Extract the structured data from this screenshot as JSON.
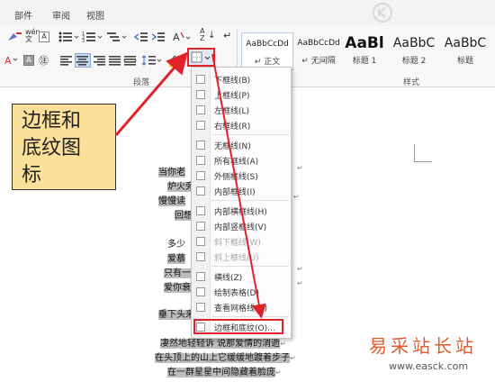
{
  "tabs": [
    "部件",
    "审阅",
    "视图"
  ],
  "ribbon": {
    "para_group_label": "段落",
    "styles_group_label": "样式",
    "font_glyphs": {
      "wen": "wén\n文",
      "a_box": "A",
      "a_shade": "A",
      "a_color": "A"
    },
    "sort_glyph": "A↓Z",
    "pilcrow": "↵"
  },
  "styles": [
    {
      "sample": "AaBbCcDd",
      "name": "↵ 正文"
    },
    {
      "sample": "AaBbCcDd",
      "name": "↵ 无间隔"
    },
    {
      "sample": "AaBl",
      "name": "标题 1"
    },
    {
      "sample": "AaBbC",
      "name": "标题 2"
    },
    {
      "sample": "AaBbC",
      "name": "标题"
    }
  ],
  "border_menu": {
    "items": [
      {
        "label": "下框线(B)",
        "disabled": false
      },
      {
        "label": "上框线(P)",
        "disabled": false
      },
      {
        "label": "左框线(L)",
        "disabled": false
      },
      {
        "label": "右框线(R)",
        "disabled": false
      },
      {
        "label": "无框线(N)",
        "disabled": false
      },
      {
        "label": "所有框线(A)",
        "disabled": false
      },
      {
        "label": "外侧框线(S)",
        "disabled": false
      },
      {
        "label": "内部框线(I)",
        "disabled": false
      },
      {
        "label": "内部横框线(H)",
        "disabled": false
      },
      {
        "label": "内部竖框线(V)",
        "disabled": false
      },
      {
        "label": "斜下框线(W)",
        "disabled": true
      },
      {
        "label": "斜上框线(U)",
        "disabled": true
      },
      {
        "label": "横线(Z)",
        "disabled": false
      },
      {
        "label": "绘制表格(D)",
        "disabled": false
      },
      {
        "label": "查看网格线(G)",
        "disabled": false
      },
      {
        "label": "边框和底纹(O)...",
        "disabled": false
      }
    ]
  },
  "callout": {
    "line1": "边框和",
    "line2": "底纹图",
    "line3": "标"
  },
  "document": {
    "lines": [
      "当你老",
      "炉火旁",
      "慢慢读",
      "回想",
      "多少",
      "爱慕",
      "只有一",
      "爱你衰",
      "垂下头来",
      "凄然地轻轻诉  说那爱情的消逝",
      "在头顶上的山上它缓缓地踱着步子",
      "在一群星星中间隐藏着脸庞"
    ],
    "return_mark": "↵"
  },
  "watermark": {
    "line1": "易采站长站",
    "line2": "www.easck.com"
  },
  "colors": {
    "highlight_red": "#e0232a",
    "callout_fill": "#fbe09a",
    "selection_gray": "#bdbdbd"
  }
}
